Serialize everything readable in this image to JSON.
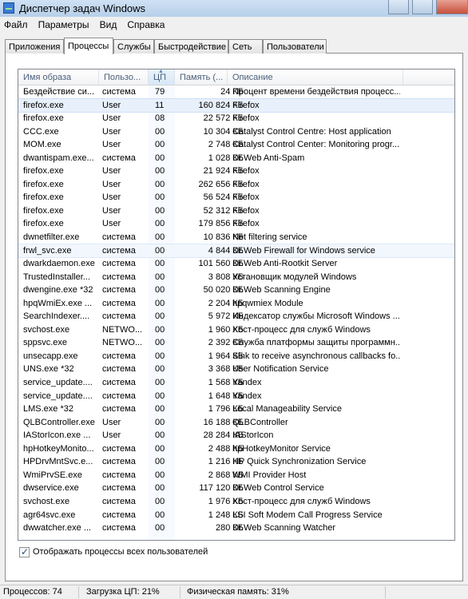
{
  "window": {
    "title": "Диспетчер задач Windows"
  },
  "menu": [
    "Файл",
    "Параметры",
    "Вид",
    "Справка"
  ],
  "tabs": [
    "Приложения",
    "Процессы",
    "Службы",
    "Быстродействие",
    "Сеть",
    "Пользователи"
  ],
  "active_tab": "Процессы",
  "columns": [
    "Имя образа",
    "Пользо...",
    "ЦП",
    "Память (...",
    "Описание"
  ],
  "rows": [
    [
      "Бездействие си...",
      "система",
      "79",
      "24 КБ",
      "Процент времени бездействия процесс..."
    ],
    [
      "firefox.exe",
      "User",
      "11",
      "160 824 КБ",
      "Firefox"
    ],
    [
      "firefox.exe",
      "User",
      "08",
      "22 572 КБ",
      "Firefox"
    ],
    [
      "CCC.exe",
      "User",
      "00",
      "10 304 КБ",
      "Catalyst Control Centre: Host application"
    ],
    [
      "MOM.exe",
      "User",
      "00",
      "2 748 КБ",
      "Catalyst Control Center: Monitoring progr..."
    ],
    [
      "dwantispam.exe...",
      "система",
      "00",
      "1 028 КБ",
      "Dr.Web Anti-Spam"
    ],
    [
      "firefox.exe",
      "User",
      "00",
      "21 924 КБ",
      "Firefox"
    ],
    [
      "firefox.exe",
      "User",
      "00",
      "262 656 КБ",
      "Firefox"
    ],
    [
      "firefox.exe",
      "User",
      "00",
      "56 524 КБ",
      "Firefox"
    ],
    [
      "firefox.exe",
      "User",
      "00",
      "52 312 КБ",
      "Firefox"
    ],
    [
      "firefox.exe",
      "User",
      "00",
      "179 856 КБ",
      "Firefox"
    ],
    [
      "dwnetfilter.exe",
      "система",
      "00",
      "10 836 КБ",
      "Net filtering service"
    ],
    [
      "frwl_svc.exe",
      "система",
      "00",
      "4 844 КБ",
      "Dr.Web Firewall for Windows service"
    ],
    [
      "dwarkdaemon.exe",
      "система",
      "00",
      "101 560 КБ",
      "Dr.Web Anti-Rootkit Server"
    ],
    [
      "TrustedInstaller...",
      "система",
      "00",
      "3 808 КБ",
      "Установщик модулей Windows"
    ],
    [
      "dwengine.exe *32",
      "система",
      "00",
      "50 020 КБ",
      "Dr.Web Scanning Engine"
    ],
    [
      "hpqWmiEx.exe ...",
      "система",
      "00",
      "2 204 КБ",
      "hpqwmiex Module"
    ],
    [
      "SearchIndexer....",
      "система",
      "00",
      "5 972 КБ",
      "Индексатор службы Microsoft Windows ..."
    ],
    [
      "svchost.exe",
      "NETWO...",
      "00",
      "1 960 КБ",
      "Хост-процесс для служб Windows"
    ],
    [
      "sppsvc.exe",
      "NETWO...",
      "00",
      "2 392 КБ",
      "Служба платформы защиты программн..."
    ],
    [
      "unsecapp.exe",
      "система",
      "00",
      "1 964 КБ",
      "Sink to receive asynchronous callbacks fo..."
    ],
    [
      "UNS.exe *32",
      "система",
      "00",
      "3 368 КБ",
      "User Notification Service"
    ],
    [
      "service_update....",
      "система",
      "00",
      "1 568 КБ",
      "Yandex"
    ],
    [
      "service_update....",
      "система",
      "00",
      "1 648 КБ",
      "Yandex"
    ],
    [
      "LMS.exe *32",
      "система",
      "00",
      "1 796 КБ",
      "Local Manageability Service"
    ],
    [
      "QLBController.exe",
      "User",
      "00",
      "16 188 КБ",
      "QLBController"
    ],
    [
      "IAStorIcon.exe ...",
      "User",
      "00",
      "28 284 КБ",
      "IAStorIcon"
    ],
    [
      "hpHotkeyMonito...",
      "система",
      "00",
      "2 488 КБ",
      "hpHotkeyMonitor Service"
    ],
    [
      "HPDrvMntSvc.e...",
      "система",
      "00",
      "1 216 КБ",
      "HP Quick Synchronization Service"
    ],
    [
      "WmiPrvSE.exe",
      "система",
      "00",
      "2 868 КБ",
      "WMI Provider Host"
    ],
    [
      "dwservice.exe",
      "система",
      "00",
      "117 120 КБ",
      "Dr.Web Control Service"
    ],
    [
      "svchost.exe",
      "система",
      "00",
      "1 976 КБ",
      "Хост-процесс для служб Windows"
    ],
    [
      "agr64svc.exe",
      "система",
      "00",
      "1 248 КБ",
      "LSI Soft Modem Call Progress Service"
    ],
    [
      "dwwatcher.exe ...",
      "система",
      "00",
      "280 КБ",
      "Dr.Web Scanning Watcher"
    ]
  ],
  "show_all_users": {
    "label": "Отображать процессы всех пользователей",
    "checked": true
  },
  "status": {
    "processes": "Процессов: 74",
    "cpu": "Загрузка ЦП: 21%",
    "memory": "Физическая память: 31%"
  }
}
